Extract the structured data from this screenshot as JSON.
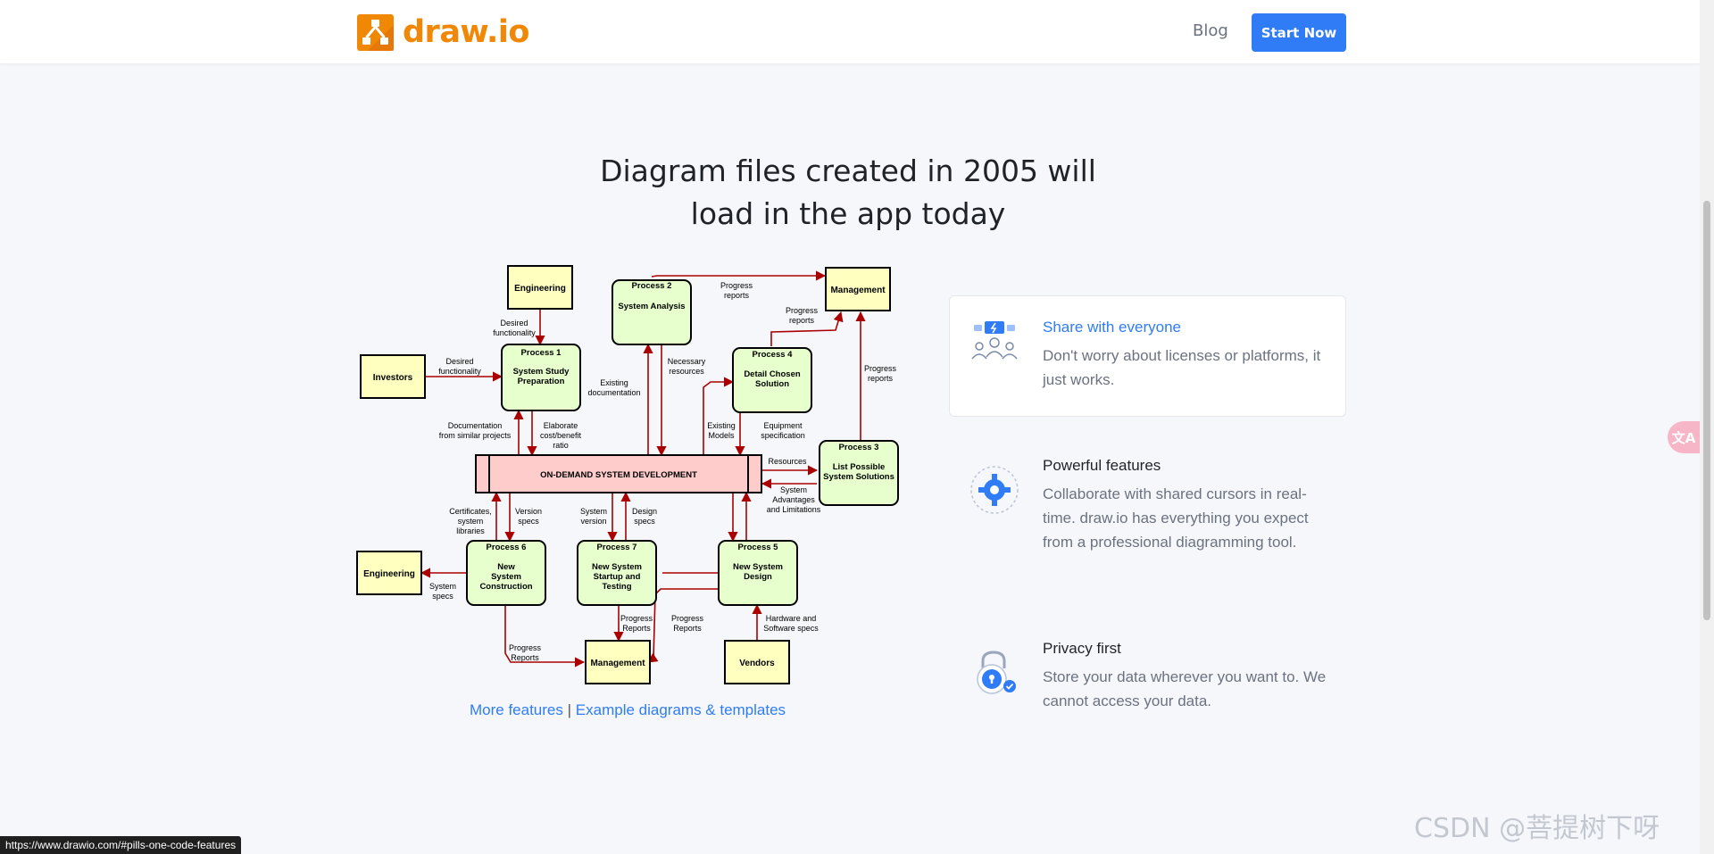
{
  "header": {
    "logo_text": "draw.io",
    "nav": {
      "blog": "Blog"
    },
    "cta": "Start Now"
  },
  "hero": {
    "headline_line1": "Diagram files created in 2005 will",
    "headline_line2": "load in the app today"
  },
  "diagram": {
    "nodes": {
      "engineering_top": "Engineering",
      "investors": "Investors",
      "management_top": "Management",
      "engineering_bottom": "Engineering",
      "management_bottom": "Management",
      "vendors": "Vendors",
      "p1_title": "Process 1",
      "p1_label": [
        "System Study",
        "Preparation"
      ],
      "p2_title": "Process 2",
      "p2_label": [
        "System Analysis"
      ],
      "p3_title": "Process 3",
      "p3_label": [
        "List Possible",
        "System Solutions"
      ],
      "p4_title": "Process 4",
      "p4_label": [
        "Detail Chosen",
        "Solution"
      ],
      "p5_title": "Process 5",
      "p5_label": [
        "New System",
        "Design"
      ],
      "p6_title": "Process 6",
      "p6_label": [
        "New",
        "System",
        "Construction"
      ],
      "p7_title": "Process 7",
      "p7_label": [
        "New System",
        "Startup and",
        "Testing"
      ],
      "central": "ON-DEMAND SYSTEM DEVELOPMENT"
    },
    "edge_labels": {
      "desired_func_top": [
        "Desired",
        "functionality"
      ],
      "desired_func_left": [
        "Desired",
        "functionality"
      ],
      "progress_reports_p2": [
        "Progress",
        "reports"
      ],
      "progress_reports_p4": [
        "Progress",
        "reports"
      ],
      "progress_reports_p3": [
        "Progress",
        "reports"
      ],
      "existing_documentation": [
        "Existing",
        "documentation"
      ],
      "necessary_resources": [
        "Necessary",
        "resources"
      ],
      "documentation_similar": [
        "Documentation",
        "from similar projects"
      ],
      "elaborate_cost": [
        "Elaborate",
        "cost/benefit",
        "ratio"
      ],
      "existing_models": [
        "Existing",
        "Models"
      ],
      "equipment_spec": [
        "Equipment",
        "specification"
      ],
      "resources": [
        "Resources"
      ],
      "system_advantages": [
        "System",
        "Advantages",
        "and Limitations"
      ],
      "certificates": [
        "Certificates,",
        "system",
        "libraries"
      ],
      "version_specs": [
        "Version",
        "specs"
      ],
      "system_version": [
        "System",
        "version"
      ],
      "design_specs": [
        "Design",
        "specs"
      ],
      "system_specs": [
        "System",
        "specs"
      ],
      "progress_reports_p7": [
        "Progress",
        "Reports"
      ],
      "progress_reports_p5": [
        "Progress",
        "Reports"
      ],
      "progress_reports_p6": [
        "Progress",
        "Reports"
      ],
      "hardware_software": [
        "Hardware and",
        "Software specs"
      ]
    }
  },
  "links": {
    "more_features": "More features",
    "separator": "|",
    "examples": "Example diagrams & templates"
  },
  "features": [
    {
      "title": "Share with everyone",
      "description": "Don't worry about licenses or platforms, it just works.",
      "icon": "share-users-icon",
      "title_color": "#2f7cf6"
    },
    {
      "title": "Powerful features",
      "description": "Collaborate with shared cursors in real-time. draw.io has everything you expect from a professional diagramming tool.",
      "icon": "gear-icon",
      "title_color": "#1f2328"
    },
    {
      "title": "Privacy first",
      "description": "Store your data wherever you want to. We cannot access your data.",
      "icon": "lock-icon",
      "title_color": "#1f2328"
    }
  ],
  "status_bar": {
    "url": "https://www.drawio.com/#pills-one-code-features"
  },
  "watermark": "CSDN @菩提树下呀",
  "translate_label": "文A"
}
